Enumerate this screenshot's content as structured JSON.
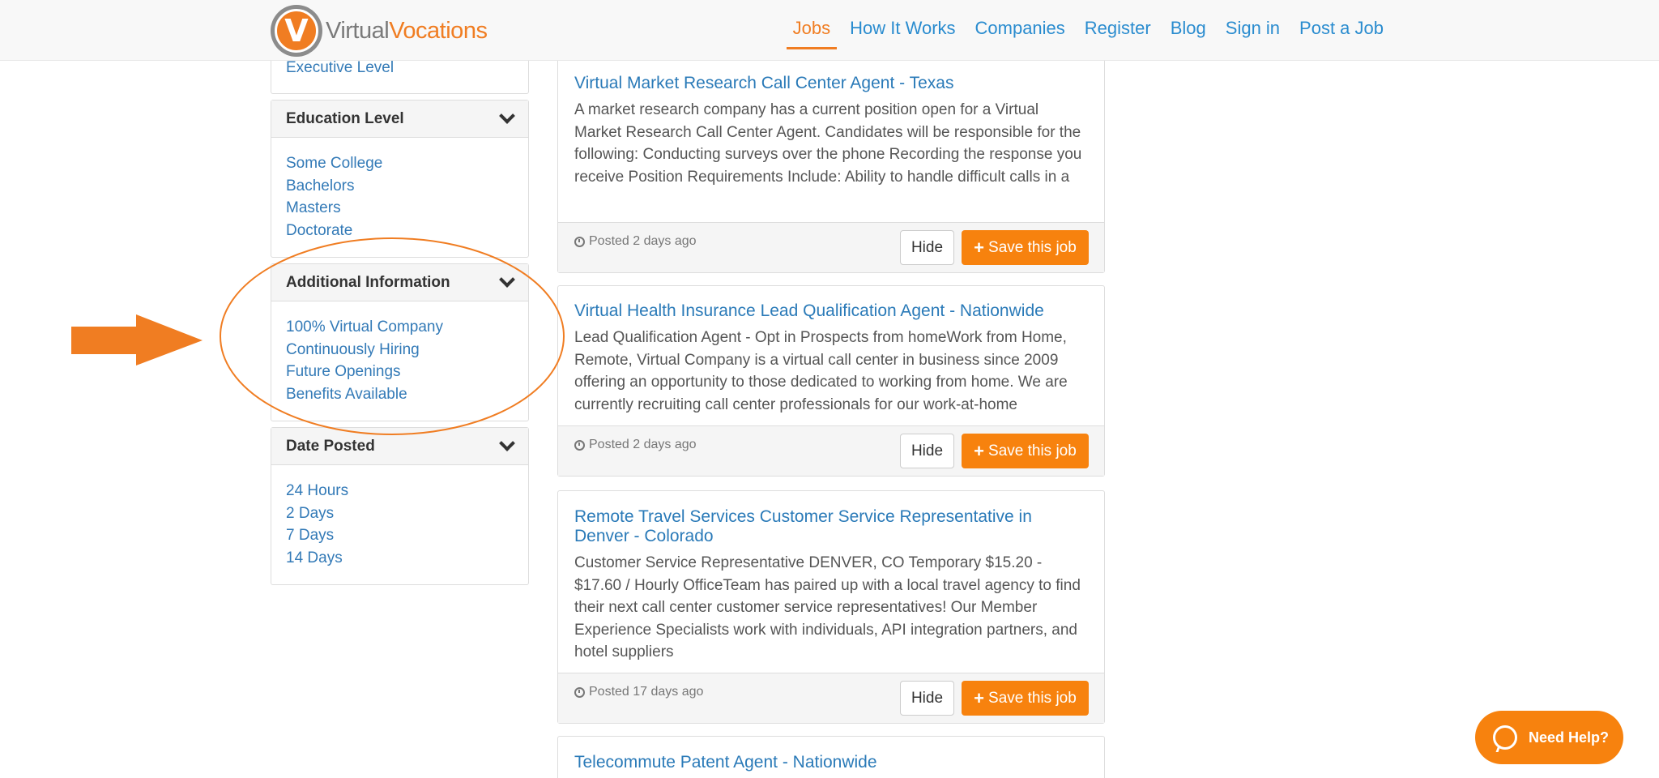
{
  "header": {
    "logo_part1": "Virtual",
    "logo_part2": "Vocations",
    "logo_letter": "V",
    "nav": [
      "Jobs",
      "How It Works",
      "Companies",
      "Register",
      "Blog",
      "Sign in",
      "Post a Job"
    ],
    "active_nav": "Jobs"
  },
  "sidebar": {
    "top_partial_link": "Executive Level",
    "panels": [
      {
        "title": "Education Level",
        "items": [
          "Some College",
          "Bachelors",
          "Masters",
          "Doctorate"
        ]
      },
      {
        "title": "Additional Information",
        "items": [
          "100% Virtual Company",
          "Continuously Hiring",
          "Future Openings",
          "Benefits Available"
        ]
      },
      {
        "title": "Date Posted",
        "items": [
          "24 Hours",
          "2 Days",
          "7 Days",
          "14 Days"
        ]
      }
    ]
  },
  "jobs": [
    {
      "title": "Virtual Market Research Call Center Agent - Texas",
      "desc": "A market research company has a current position open for a Virtual Market Research Call Center Agent. Candidates will be responsible for the following: Conducting surveys over the phone Recording the response you receive Position Requirements Include: Ability to handle difficult calls in a",
      "posted": "Posted 2 days ago"
    },
    {
      "title": "Virtual Health Insurance Lead Qualification Agent - Nationwide",
      "desc": "Lead Qualification Agent - Opt in Prospects from homeWork from Home, Remote, Virtual Company is a virtual call center in business since 2009 offering an opportunity to those dedicated to working from home. We are currently recruiting call center professionals for our work-at-home",
      "posted": "Posted 2 days ago"
    },
    {
      "title": "Remote Travel Services Customer Service Representative in Denver - Colorado",
      "desc": "Customer Service Representative DENVER, CO Temporary $15.20 - $17.60 / Hourly OfficeTeam has paired up with a local travel agency to find their next call center customer service representatives! Our Member Experience Specialists work with individuals, API integration partners, and hotel suppliers",
      "posted": "Posted 17 days ago"
    },
    {
      "title": "Telecommute Patent Agent - Nationwide"
    }
  ],
  "buttons": {
    "hide": "Hide",
    "save": "Save this job",
    "save_icon": "plus-icon"
  },
  "help": {
    "label": "Need Help?",
    "icon": "chat-bubble-icon"
  },
  "annotation": {
    "color": "#f07d22",
    "shapes": [
      "arrow",
      "ellipse"
    ]
  },
  "colors": {
    "accent": "#f07d22",
    "link": "#337ab7",
    "nav_link": "#2a8ccf",
    "button": "#f7820e"
  }
}
